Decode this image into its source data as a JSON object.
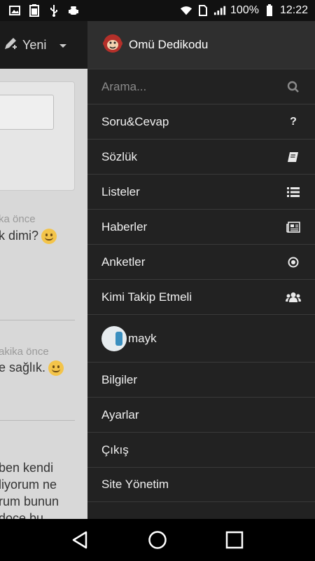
{
  "status_bar": {
    "battery": "100%",
    "time": "12:22",
    "icons": [
      "gallery-icon",
      "battery-100-icon",
      "usb-icon",
      "android-debug-icon",
      "wifi-icon",
      "sim-icon",
      "signal-icon",
      "battery-icon"
    ]
  },
  "background_app": {
    "toolbar_label": "Yeni",
    "posts": [
      {
        "meta": "ka önce",
        "text": "k dimi?"
      },
      {
        "meta": "akika önce",
        "text": "e sağlık."
      },
      {
        "lines": [
          "ben kendi",
          "liyorum ne",
          "rum bunun",
          "doce bu"
        ]
      }
    ]
  },
  "drawer": {
    "title": "Omü Dedikodu",
    "search_placeholder": "Arama...",
    "items": [
      {
        "label": "Soru&Cevap",
        "icon": "question-icon"
      },
      {
        "label": "Sözlük",
        "icon": "book-icon"
      },
      {
        "label": "Listeler",
        "icon": "list-icon"
      },
      {
        "label": "Haberler",
        "icon": "newspaper-icon"
      },
      {
        "label": "Anketler",
        "icon": "dot-circle-icon"
      },
      {
        "label": "Kimi Takip Etmeli",
        "icon": "users-icon"
      }
    ],
    "user": {
      "name": "mayk"
    },
    "bottom_items": [
      {
        "label": "Bilgiler"
      },
      {
        "label": "Ayarlar"
      },
      {
        "label": "Çıkış"
      },
      {
        "label": "Site Yönetim"
      }
    ]
  }
}
